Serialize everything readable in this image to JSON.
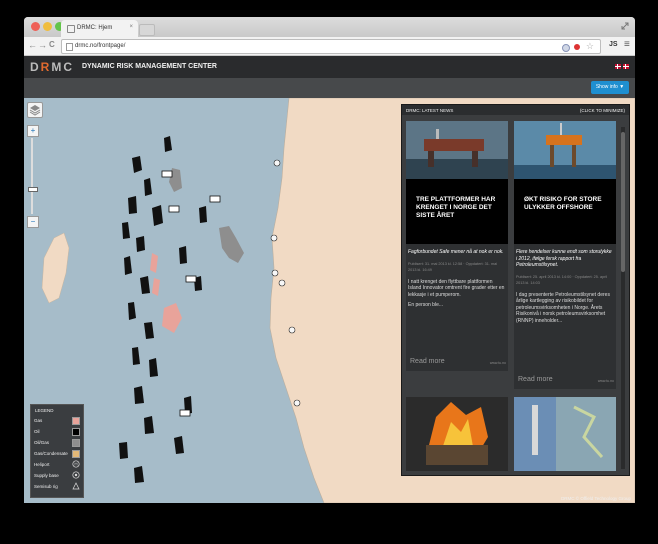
{
  "browser": {
    "tab_title": "DRMC: Hjem",
    "tab_close": "×",
    "url": "drmc.no/frontpage/",
    "nav_back": "←",
    "nav_forward": "→",
    "nav_reload": "C",
    "ext_js": "JS",
    "menu_icon": "≡"
  },
  "site": {
    "logo_d": "D",
    "logo_r": "R",
    "logo_mc": "MC",
    "brand_title": "DYNAMIC RISK MANAGEMENT CENTER",
    "show_info": "Show info ▼"
  },
  "map": {
    "zoom_in": "+",
    "zoom_out": "−",
    "copyright": "DRMC © Offield Technology Group",
    "legend": {
      "title": "LEGEND",
      "items": [
        {
          "label": "Gas",
          "color": "#e8a39a"
        },
        {
          "label": "Oil",
          "color": "#000000"
        },
        {
          "label": "Oil/Gas",
          "color": "#8e8e8e"
        },
        {
          "label": "Gas/Condensate",
          "color": "#e2b878"
        },
        {
          "label": "Heliport",
          "symbol": "heliport"
        },
        {
          "label": "Supply base",
          "symbol": "supply"
        },
        {
          "label": "Semisub rig",
          "symbol": "rig"
        }
      ]
    }
  },
  "news": {
    "header": "DRMC: LATEST NEWS",
    "minimize": "(CLICK TO MINIMIZE)",
    "cards": [
      {
        "title": "TRE PLATTFORMER HAR KRENGET I NORGE DET SISTE ÅRET",
        "lead": "Fagforbundet Safe mener nå at nok er nok.",
        "meta": "Publisert: 31. mai 2013 kl. 12:58 · Oppdatert: 31. mai 2013 kl. 16:49",
        "body1": "I natt krenget den flyttbare plattformen Island Innovator omtrent fire grader etter en lekkasje i et pumperom.",
        "body2": "En person ble...",
        "read_more": "Read more",
        "source": "www.tu.no"
      },
      {
        "title": "ØKT RISIKO FOR STORE ULYKKER OFFSHORE",
        "lead": "Flere hendelser kunne endt som storulykke i 2012, ifølge fersk rapport fra Petroleumstilsynet.",
        "meta": "Publisert: 25. april 2013 kl. 14:00 · Oppdatert: 25. april 2013 kl. 14:03",
        "body1": "I dag presenterte Petroleumstilsynet deres årlige kartlegging av risikobildet for petroleumsvirksomheten i Norge. Årets Risikonivå i norsk petroleumsvirksomhet (RNNP) inneholder...",
        "body2": "",
        "read_more": "Read more",
        "source": "www.tu.no"
      }
    ]
  }
}
